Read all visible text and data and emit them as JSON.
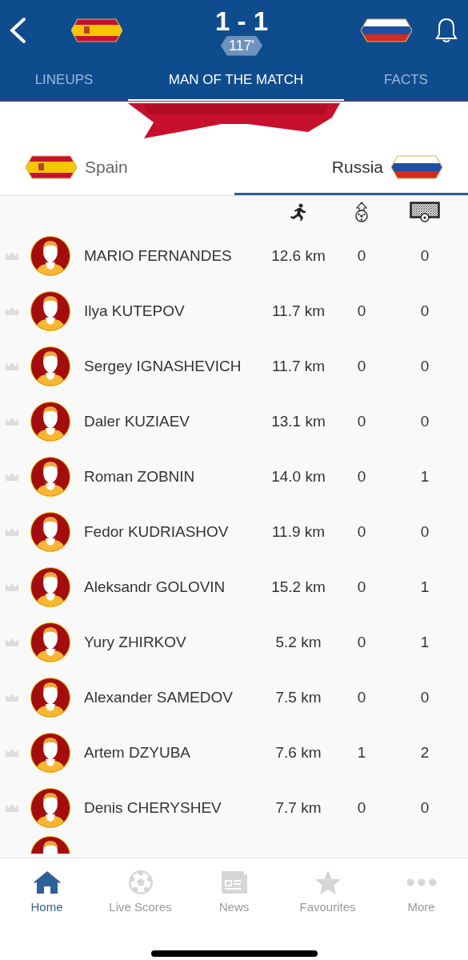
{
  "header": {
    "score": "1 - 1",
    "minute": "117'"
  },
  "tabs": [
    {
      "label": "LINEUPS",
      "selected": false
    },
    {
      "label": "MAN OF THE MATCH",
      "selected": true
    },
    {
      "label": "FACTS",
      "selected": false
    }
  ],
  "team_toggle": [
    {
      "label": "Spain",
      "selected": false
    },
    {
      "label": "Russia",
      "selected": true
    }
  ],
  "players": [
    {
      "name": "MARIO FERNANDES",
      "distance": "12.6 km",
      "stat_2": "0",
      "stat_3": "0"
    },
    {
      "name": "Ilya KUTEPOV",
      "distance": "11.7 km",
      "stat_2": "0",
      "stat_3": "0"
    },
    {
      "name": "Sergey IGNASHEVICH",
      "distance": "11.7 km",
      "stat_2": "0",
      "stat_3": "0"
    },
    {
      "name": "Daler KUZIAEV",
      "distance": "13.1 km",
      "stat_2": "0",
      "stat_3": "0"
    },
    {
      "name": "Roman ZOBNIN",
      "distance": "14.0 km",
      "stat_2": "0",
      "stat_3": "1"
    },
    {
      "name": "Fedor KUDRIASHOV",
      "distance": "11.9 km",
      "stat_2": "0",
      "stat_3": "0"
    },
    {
      "name": "Aleksandr GOLOVIN",
      "distance": "15.2 km",
      "stat_2": "0",
      "stat_3": "1"
    },
    {
      "name": "Yury ZHIRKOV",
      "distance": "5.2 km",
      "stat_2": "0",
      "stat_3": "1"
    },
    {
      "name": "Alexander SAMEDOV",
      "distance": "7.5 km",
      "stat_2": "0",
      "stat_3": "0"
    },
    {
      "name": "Artem DZYUBA",
      "distance": "7.6 km",
      "stat_2": "1",
      "stat_3": "2"
    },
    {
      "name": "Denis CHERYSHEV",
      "distance": "7.7 km",
      "stat_2": "0",
      "stat_3": "0"
    }
  ],
  "bottom_nav": [
    {
      "label": "Home",
      "kind": "home",
      "selected": true
    },
    {
      "label": "Live Scores",
      "kind": "ball",
      "selected": false
    },
    {
      "label": "News",
      "kind": "news",
      "selected": false
    },
    {
      "label": "Favourites",
      "kind": "star",
      "selected": false
    },
    {
      "label": "More",
      "kind": "more",
      "selected": false
    }
  ]
}
